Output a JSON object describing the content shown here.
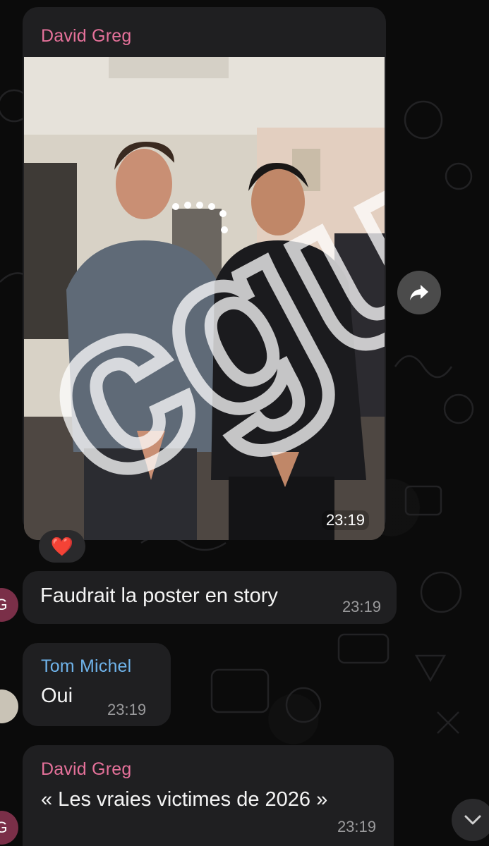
{
  "messages": {
    "photo_message": {
      "sender": "David Greg",
      "time": "23:19",
      "reaction": "❤️",
      "watermark": "cgu"
    },
    "msg2": {
      "text": "Faudrait la poster en story",
      "time": "23:19"
    },
    "msg3": {
      "sender": "Tom Michel",
      "text": "Oui",
      "time": "23:19"
    },
    "msg4": {
      "sender": "David Greg",
      "text": "« Les vraies victimes de 2026 »",
      "time": "23:19"
    }
  },
  "avatars": {
    "g_initial": "G"
  },
  "colors": {
    "background": "#0b0b0b",
    "bubble": "#1f1f21",
    "sender_pink": "#e5719a",
    "sender_blue": "#6fb3ea",
    "timestamp": "#9a9a9c"
  },
  "icons": {
    "forward": "forward-arrow-icon",
    "scroll_down": "chevron-down-icon",
    "reaction": "heart-icon"
  }
}
